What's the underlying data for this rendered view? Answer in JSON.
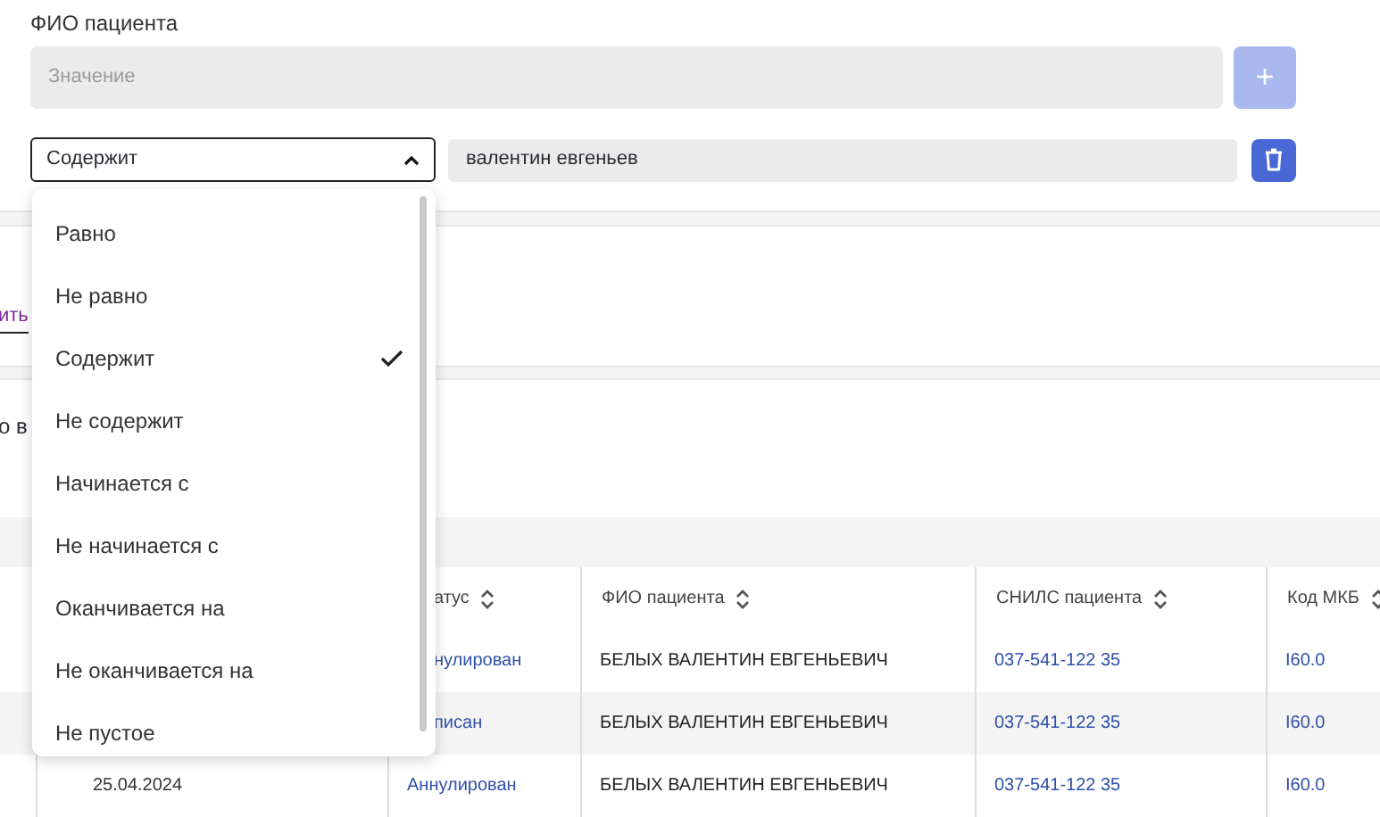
{
  "filter": {
    "label": "ФИО пациента",
    "value_placeholder": "Значение",
    "add_button": {
      "label": "+",
      "disabled": true
    },
    "condition": {
      "value": "Содержит",
      "expanded": true
    },
    "condition_value": "валентин евгеньев"
  },
  "dropdown": {
    "options": [
      {
        "label": "Равно",
        "selected": false
      },
      {
        "label": "Не равно",
        "selected": false
      },
      {
        "label": "Содержит",
        "selected": true
      },
      {
        "label": "Не содержит",
        "selected": false
      },
      {
        "label": "Начинается с",
        "selected": false
      },
      {
        "label": "Не начинается с",
        "selected": false
      },
      {
        "label": "Оканчивается на",
        "selected": false
      },
      {
        "label": "Не оканчивается на",
        "selected": false
      },
      {
        "label": "Не пустое",
        "selected": false
      }
    ]
  },
  "background_fragments": {
    "link": "ить",
    "text": "о в"
  },
  "table": {
    "columns": [
      "атус",
      "ФИО пациента",
      "СНИЛС пациента",
      "Код МКБ"
    ],
    "rows": [
      {
        "status": "нулирован",
        "patient": "БЕЛЫХ ВАЛЕНТИН ЕВГЕНЬЕВИЧ",
        "snils": "037-541-122 35",
        "mkb": "I60.0"
      },
      {
        "status": "писан",
        "patient": "БЕЛЫХ ВАЛЕНТИН ЕВГЕНЬЕВИЧ",
        "snils": "037-541-122 35",
        "mkb": "I60.0"
      },
      {
        "date": "25.04.2024",
        "status": "Аннулирован",
        "patient": "БЕЛЫХ ВАЛЕНТИН ЕВГЕНЬЕВИЧ",
        "snils": "037-541-122 35",
        "mkb": "I60.0"
      }
    ]
  }
}
